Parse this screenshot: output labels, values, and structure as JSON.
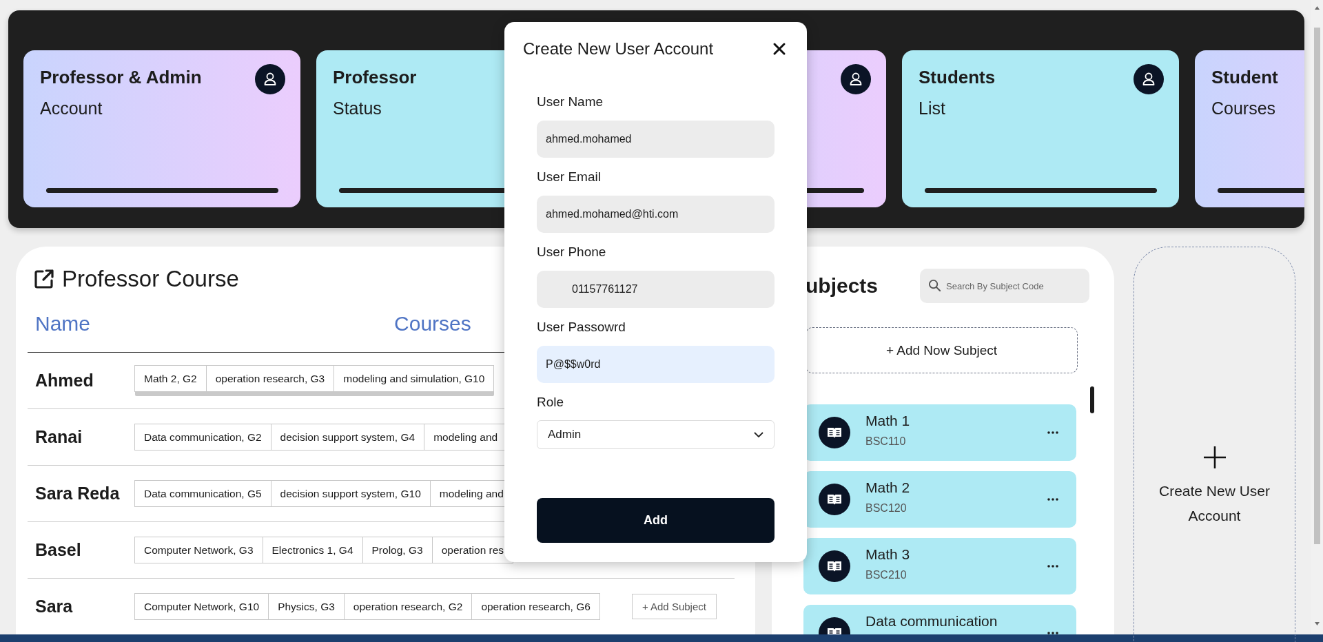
{
  "stat_cards": [
    {
      "title": "Professor & Admin",
      "subtitle": "Account",
      "kind": "gradient",
      "icon": true
    },
    {
      "title": "Professor",
      "subtitle": "Status",
      "kind": "plain"
    },
    {
      "kind": "gradient",
      "icon": true
    },
    {
      "title": "Students",
      "subtitle": "List",
      "kind": "plain",
      "icon": true
    },
    {
      "title": "Student",
      "subtitle": "Courses",
      "kind": "gradient"
    }
  ],
  "professor_course": {
    "title": "Professor Course",
    "columns": [
      "Name",
      "Courses"
    ],
    "rows": [
      {
        "name": "Ahmed",
        "scrollable": true,
        "courses": [
          "Math 2, G2",
          "operation research, G3",
          "modeling and simulation, G10"
        ]
      },
      {
        "name": "Ranai",
        "scrollable": false,
        "courses": [
          "Data communication, G2",
          "decision support system, G4",
          "modeling and"
        ]
      },
      {
        "name": "Sara Reda",
        "scrollable": false,
        "courses": [
          "Data communication, G5",
          "decision support system, G10",
          "modeling and"
        ]
      },
      {
        "name": "Basel",
        "scrollable": false,
        "courses": [
          "Computer Network, G3",
          "Electronics 1, G4",
          "Prolog, G3",
          "operation res"
        ]
      },
      {
        "name": "Sara",
        "scrollable": false,
        "courses": [
          "Computer Network, G10",
          "Physics, G3",
          "operation research, G2",
          "operation research, G6"
        ],
        "add_button": "+ Add Subject"
      }
    ]
  },
  "subjects": {
    "title": "ubjects",
    "search": {
      "placeholder": "Search By Subject Code"
    },
    "add_button": "+ Add Now Subject",
    "items": [
      {
        "name": "Math 1",
        "code": "BSC110"
      },
      {
        "name": "Math 2",
        "code": "BSC120"
      },
      {
        "name": "Math 3",
        "code": "BSC210"
      },
      {
        "name": "Data communication"
      }
    ]
  },
  "create_card": {
    "label": "Create New User Account"
  },
  "modal": {
    "title": "Create New User Account",
    "fields": [
      {
        "label": "User Name",
        "value": "ahmed.mohamed",
        "kind": "text",
        "focused": false
      },
      {
        "label": "User Email",
        "value": "ahmed.mohamed@hti.com",
        "kind": "text",
        "focused": false
      },
      {
        "label": "User Phone",
        "value": "01157761127",
        "kind": "phone",
        "focused": false
      },
      {
        "label": "User Passowrd",
        "value": "P@$$w0rd",
        "kind": "text",
        "focused": true
      }
    ],
    "role": {
      "label": "Role",
      "value": "Admin"
    },
    "submit": "Add"
  }
}
